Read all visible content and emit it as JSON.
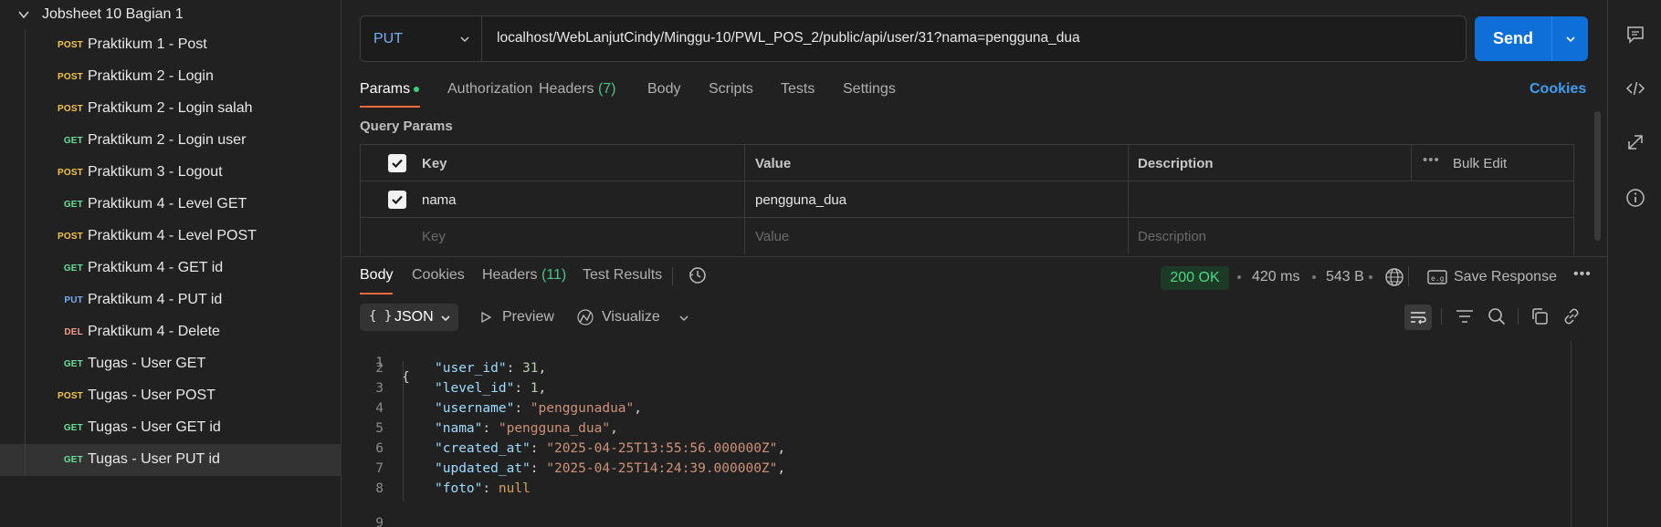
{
  "sidebar": {
    "folder": "Jobsheet 10 Bagian 1",
    "items": [
      {
        "method": "POST",
        "name": "Praktikum 1 - Post"
      },
      {
        "method": "POST",
        "name": "Praktikum 2 - Login"
      },
      {
        "method": "POST",
        "name": "Praktikum 2 - Login salah"
      },
      {
        "method": "GET",
        "name": "Praktikum 2 - Login user"
      },
      {
        "method": "POST",
        "name": "Praktikum 3 - Logout"
      },
      {
        "method": "GET",
        "name": "Praktikum 4 - Level GET"
      },
      {
        "method": "POST",
        "name": "Praktikum 4 - Level POST"
      },
      {
        "method": "GET",
        "name": "Praktikum 4 - GET id"
      },
      {
        "method": "PUT",
        "name": "Praktikum 4 - PUT id"
      },
      {
        "method": "DEL",
        "name": "Praktikum 4 - Delete"
      },
      {
        "method": "GET",
        "name": "Tugas - User GET"
      },
      {
        "method": "POST",
        "name": "Tugas - User POST"
      },
      {
        "method": "GET",
        "name": "Tugas - User GET id"
      },
      {
        "method": "GET",
        "name": "Tugas - User PUT id"
      }
    ]
  },
  "request": {
    "method": "PUT",
    "url": "localhost/WebLanjutCindy/Minggu-10/PWL_POS_2/public/api/user/31?nama=pengguna_dua",
    "send_label": "Send",
    "tabs": {
      "params": "Params",
      "authorization": "Authorization",
      "headers": "Headers",
      "headers_count": "(7)",
      "body": "Body",
      "scripts": "Scripts",
      "tests": "Tests",
      "settings": "Settings"
    },
    "cookies_link": "Cookies",
    "query_params_title": "Query Params",
    "columns": {
      "key": "Key",
      "value": "Value",
      "description": "Description",
      "bulk_edit": "Bulk Edit"
    },
    "params": [
      {
        "key": "nama",
        "value": "pengguna_dua",
        "description": ""
      }
    ],
    "placeholders": {
      "key": "Key",
      "value": "Value",
      "description": "Description"
    }
  },
  "response": {
    "tabs": {
      "body": "Body",
      "cookies": "Cookies",
      "headers": "Headers",
      "headers_count": "(11)",
      "test_results": "Test Results"
    },
    "status": "200 OK",
    "time": "420 ms",
    "size": "543 B",
    "save_response": "Save Response",
    "format": "JSON",
    "format_braces": "{ }",
    "preview": "Preview",
    "visualize": "Visualize",
    "body_lines": [
      "1",
      "2",
      "3",
      "4",
      "5",
      "6",
      "7",
      "8",
      "9"
    ],
    "json": {
      "open": "{",
      "close": "}",
      "fields": [
        {
          "key": "\"user_id\"",
          "value": "31",
          "type": "number",
          "comma": ","
        },
        {
          "key": "\"level_id\"",
          "value": "1",
          "type": "number",
          "comma": ","
        },
        {
          "key": "\"username\"",
          "value": "\"penggunadua\"",
          "type": "string",
          "comma": ","
        },
        {
          "key": "\"nama\"",
          "value": "\"pengguna_dua\"",
          "type": "string",
          "comma": ","
        },
        {
          "key": "\"created_at\"",
          "value": "\"2025-04-25T13:55:56.000000Z\"",
          "type": "string",
          "comma": ","
        },
        {
          "key": "\"updated_at\"",
          "value": "\"2025-04-25T14:24:39.000000Z\"",
          "type": "string",
          "comma": ","
        },
        {
          "key": "\"foto\"",
          "value": "null",
          "type": "keyword",
          "comma": ""
        }
      ]
    }
  },
  "colors": {
    "accent": "#0e6fd9",
    "tab_underline": "#ef6c3a",
    "post": "#f5c542",
    "get": "#6bdd9a",
    "put": "#74aef6",
    "del": "#f59d8d",
    "status_ok": "#4cd787"
  }
}
